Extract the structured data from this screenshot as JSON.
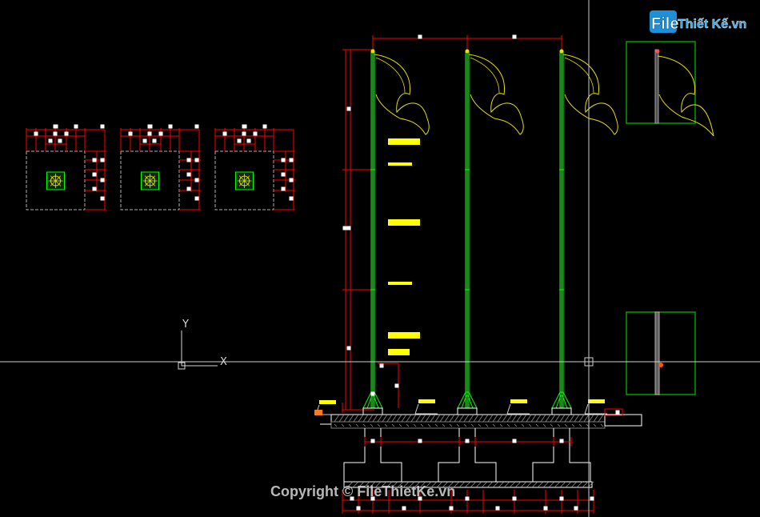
{
  "canvas": {
    "background": "#000000"
  },
  "colors": {
    "dimension": "#ff0000",
    "pole": "#00ff00",
    "flag": "#e8e000",
    "label": "#ffff00",
    "base": "#ffffff",
    "hatch": "#9a9a9a",
    "frame": "#00a000",
    "grip": "#ffffff",
    "ucs": "#d8d8d8",
    "crosshair": "#d0d0d0",
    "watermark": "#d8d8d8"
  },
  "watermark": {
    "logo_file": "File",
    "logo_rest": "Thiết Kế.vn",
    "copyright": "Copyright © FileThietKe.vn"
  },
  "ucs": {
    "y_label": "Y",
    "x_label": "X"
  },
  "drawing": {
    "plan_views": 3,
    "flag_poles": 3,
    "detail_frames": 2
  }
}
